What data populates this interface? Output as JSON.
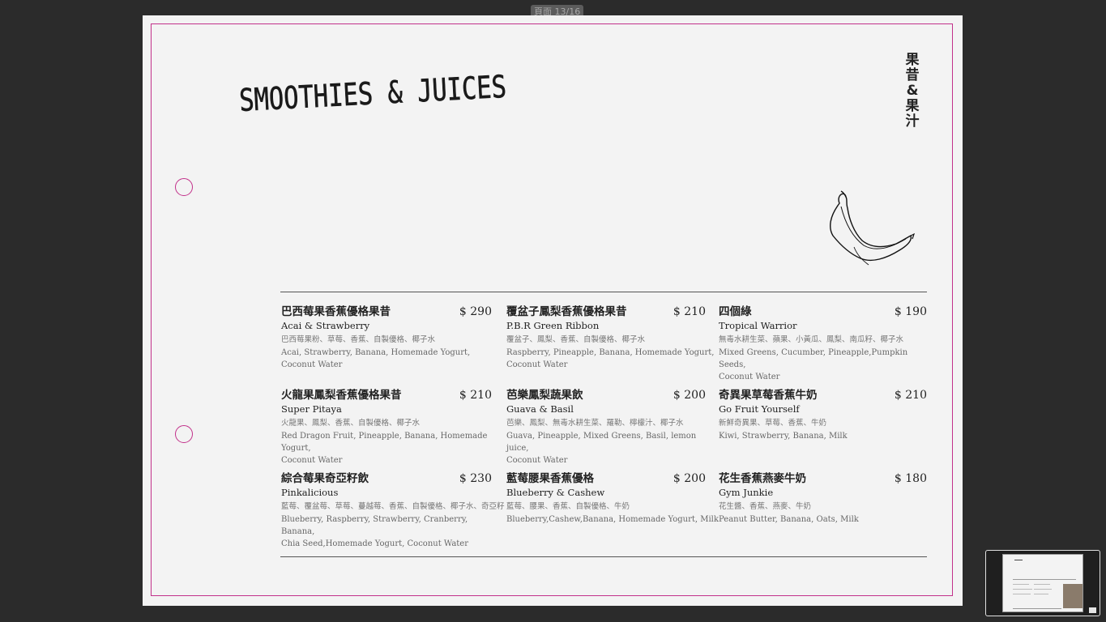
{
  "viewer": {
    "page_indicator": "頁面 13/16"
  },
  "page": {
    "title": "SMOOTHIES & JUICES",
    "vertical_title": [
      "果",
      "昔",
      "&",
      "果",
      "汁"
    ],
    "banana_icon": "banana-sketch-icon",
    "accent_color": "#c2308a"
  },
  "menu": {
    "items": [
      {
        "zh_name": "巴西莓果香蕉優格果昔",
        "price": "$ 290",
        "en_name": "Acai & Strawberry",
        "zh_ingredients": "巴西莓果粉、草莓、香蕉、自製優格、椰子水",
        "en_ingredients": "Acai,  Strawberry, Banana, Homemade Yogurt,\nCoconut Water"
      },
      {
        "zh_name": "覆盆子鳳梨香蕉優格果昔",
        "price": "$ 210",
        "en_name": "P.B.R Green Ribbon",
        "zh_ingredients": "覆盆子、鳳梨、香蕉、自製優格、椰子水",
        "en_ingredients": "Raspberry, Pineapple, Banana, Homemade Yogurt,\nCoconut Water"
      },
      {
        "zh_name": "四個綠",
        "price": "$ 190",
        "en_name": "Tropical Warrior",
        "zh_ingredients": "無毒水耕生菜、蘋果、小黃瓜、鳳梨、南瓜籽、椰子水",
        "en_ingredients": "Mixed Greens, Cucumber, Pineapple,Pumpkin Seeds,\n Coconut Water"
      },
      {
        "zh_name": "火龍果鳳梨香蕉優格果昔",
        "price": "$ 210",
        "en_name": "Super Pitaya",
        "zh_ingredients": "火龍果、鳳梨、香蕉、自製優格、椰子水",
        "en_ingredients": "Red Dragon Fruit, Pineapple, Banana, Homemade Yogurt,\nCoconut Water"
      },
      {
        "zh_name": "芭樂鳳梨蔬果飲",
        "price": "$ 200",
        "en_name": "Guava & Basil",
        "zh_ingredients": "芭樂、鳳梨、無毒水耕生菜、羅勒、檸檬汁、椰子水",
        "en_ingredients": "Guava, Pineapple, Mixed Greens, Basil, lemon juice,\nCoconut Water"
      },
      {
        "zh_name": "奇異果草莓香蕉牛奶",
        "price": "$ 210",
        "en_name": "Go Fruit Yourself",
        "zh_ingredients": "新鮮奇異果、草莓、香蕉、牛奶",
        "en_ingredients": "Kiwi, Strawberry, Banana, Milk"
      },
      {
        "zh_name": "綜合莓果奇亞籽飲",
        "price": "$ 230",
        "en_name": "Pinkalicious",
        "zh_ingredients": "藍莓、覆盆莓、草莓、蔓越莓、香蕉、自製優格、椰子水、奇亞籽",
        "en_ingredients": "Blueberry, Raspberry, Strawberry, Cranberry, Banana,\nChia Seed,Homemade Yogurt, Coconut Water"
      },
      {
        "zh_name": "藍莓腰果香蕉優格",
        "price": "$ 200",
        "en_name": "Blueberry & Cashew",
        "zh_ingredients": "藍莓、腰果、香蕉、自製優格、牛奶",
        "en_ingredients": "Blueberry,Cashew,Banana, Homemade Yogurt, Milk"
      },
      {
        "zh_name": "花生香蕉燕麥牛奶",
        "price": "$ 180",
        "en_name": "Gym Junkie",
        "zh_ingredients": "花生醬、香蕉、燕麥、牛奶",
        "en_ingredients": "Peanut Butter, Banana, Oats, Milk"
      }
    ]
  },
  "thumbnail": {
    "label": "page-thumbnail"
  }
}
